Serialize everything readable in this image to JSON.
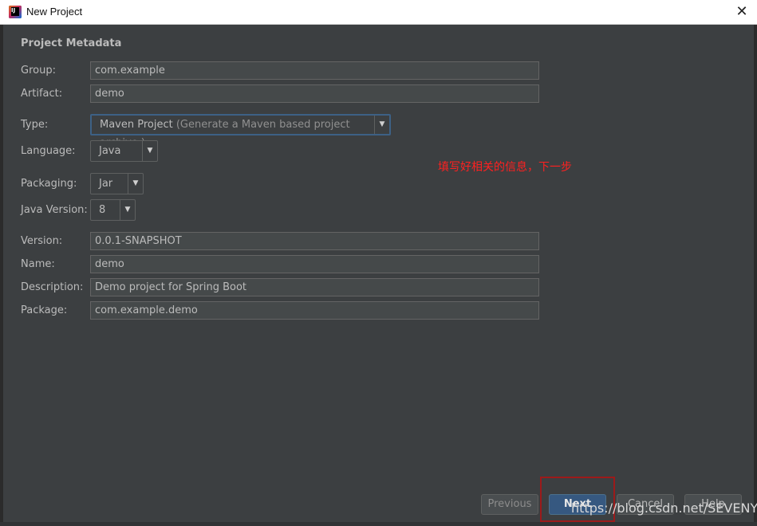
{
  "window": {
    "title": "New Project",
    "close_glyph": "✕"
  },
  "section_title": "Project Metadata",
  "fields": {
    "group": {
      "label": "Group:",
      "value": "com.example"
    },
    "artifact": {
      "label": "Artifact:",
      "value": "demo"
    },
    "version": {
      "label": "Version:",
      "value": "0.0.1-SNAPSHOT"
    },
    "name": {
      "label": "Name:",
      "value": "demo"
    },
    "description": {
      "label": "Description:",
      "value": "Demo project for Spring Boot"
    },
    "package": {
      "label": "Package:",
      "value": "com.example.demo"
    }
  },
  "selects": {
    "type": {
      "label": "Type:",
      "value": "Maven Project",
      "hint": "(Generate a Maven based project archive.)"
    },
    "language": {
      "label": "Language:",
      "value": "Java"
    },
    "packaging": {
      "label": "Packaging:",
      "value": "Jar"
    },
    "java_version": {
      "label": "Java Version:",
      "value": "8"
    }
  },
  "annotation": "填写好相关的信息，下一步",
  "buttons": {
    "previous": "Previous",
    "next": "Next",
    "cancel": "Cancel",
    "help": "Help"
  },
  "watermark": "https://blog.csdn.net/SEVENY_",
  "icons": {
    "app": "intellij-idea-icon",
    "close": "close-icon",
    "dropdown": "chevron-down-icon"
  },
  "colors": {
    "background": "#3c3f41",
    "field": "#45494a",
    "accent": "#365880",
    "annotation": "#ff2020",
    "highlight": "#9c1a1a"
  }
}
